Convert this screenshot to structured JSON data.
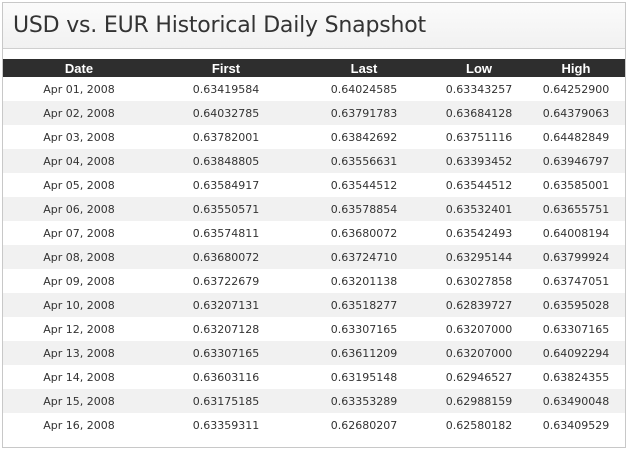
{
  "title": "USD vs. EUR Historical Daily Snapshot",
  "table": {
    "headers": [
      "Date",
      "First",
      "Last",
      "Low",
      "High"
    ],
    "rows": [
      [
        "Apr 01, 2008",
        "0.63419584",
        "0.64024585",
        "0.63343257",
        "0.64252900"
      ],
      [
        "Apr 02, 2008",
        "0.64032785",
        "0.63791783",
        "0.63684128",
        "0.64379063"
      ],
      [
        "Apr 03, 2008",
        "0.63782001",
        "0.63842692",
        "0.63751116",
        "0.64482849"
      ],
      [
        "Apr 04, 2008",
        "0.63848805",
        "0.63556631",
        "0.63393452",
        "0.63946797"
      ],
      [
        "Apr 05, 2008",
        "0.63584917",
        "0.63544512",
        "0.63544512",
        "0.63585001"
      ],
      [
        "Apr 06, 2008",
        "0.63550571",
        "0.63578854",
        "0.63532401",
        "0.63655751"
      ],
      [
        "Apr 07, 2008",
        "0.63574811",
        "0.63680072",
        "0.63542493",
        "0.64008194"
      ],
      [
        "Apr 08, 2008",
        "0.63680072",
        "0.63724710",
        "0.63295144",
        "0.63799924"
      ],
      [
        "Apr 09, 2008",
        "0.63722679",
        "0.63201138",
        "0.63027858",
        "0.63747051"
      ],
      [
        "Apr 10, 2008",
        "0.63207131",
        "0.63518277",
        "0.62839727",
        "0.63595028"
      ],
      [
        "Apr 12, 2008",
        "0.63207128",
        "0.63307165",
        "0.63207000",
        "0.63307165"
      ],
      [
        "Apr 13, 2008",
        "0.63307165",
        "0.63611209",
        "0.63207000",
        "0.64092294"
      ],
      [
        "Apr 14, 2008",
        "0.63603116",
        "0.63195148",
        "0.62946527",
        "0.63824355"
      ],
      [
        "Apr 15, 2008",
        "0.63175185",
        "0.63353289",
        "0.62988159",
        "0.63490048"
      ],
      [
        "Apr 16, 2008",
        "0.63359311",
        "0.62680207",
        "0.62580182",
        "0.63409529"
      ]
    ]
  }
}
